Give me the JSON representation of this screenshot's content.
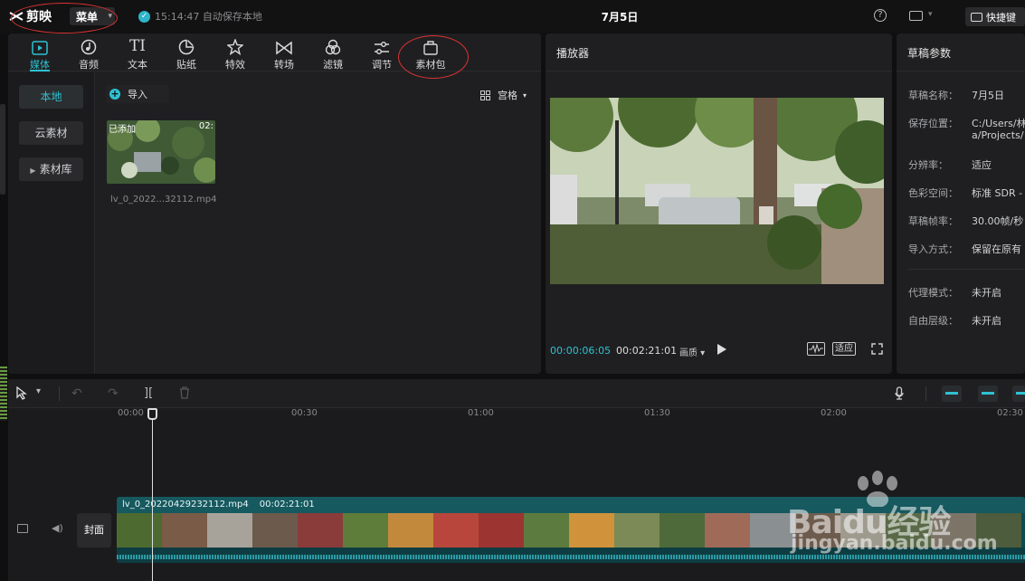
{
  "app": {
    "logo_text": "剪映",
    "menu_label": "菜单",
    "autosave_text": "15:14:47 自动保存本地",
    "project_title": "7月5日",
    "shortcut_label": "快捷键"
  },
  "tool_tabs": [
    {
      "label": "媒体",
      "icon": "media-icon"
    },
    {
      "label": "音频",
      "icon": "audio-icon"
    },
    {
      "label": "文本",
      "icon": "text-icon",
      "glyph": "TI"
    },
    {
      "label": "贴纸",
      "icon": "sticker-icon"
    },
    {
      "label": "特效",
      "icon": "effects-icon"
    },
    {
      "label": "转场",
      "icon": "transition-icon"
    },
    {
      "label": "滤镜",
      "icon": "filter-icon"
    },
    {
      "label": "调节",
      "icon": "adjust-icon"
    },
    {
      "label": "素材包",
      "icon": "material-pack-icon"
    }
  ],
  "media_sidebar": {
    "local": "本地",
    "cloud": "云素材",
    "library": "素材库"
  },
  "media": {
    "import_label": "导入",
    "view_label": "宫格",
    "added_badge": "已添加",
    "duration_short": "02:",
    "file_name": "lv_0_2022...32112.mp4"
  },
  "player": {
    "title": "播放器",
    "time_current": "00:00:06:05",
    "time_total": "00:02:21:01",
    "quality_label": "画质",
    "fit_label": "适应"
  },
  "params": {
    "title": "草稿参数",
    "rows": [
      {
        "label": "草稿名称：",
        "value": "7月5日"
      },
      {
        "label": "保存位置：",
        "value": "C:/Users/林",
        "value2": "a/Projects/"
      },
      {
        "label": "分辨率：",
        "value": "适应"
      },
      {
        "label": "色彩空间：",
        "value": "标准 SDR -"
      },
      {
        "label": "草稿帧率：",
        "value": "30.00帧/秒"
      },
      {
        "label": "导入方式：",
        "value": "保留在原有"
      },
      {
        "label": "代理模式：",
        "value": "未开启"
      },
      {
        "label": "自由层级：",
        "value": "未开启"
      }
    ]
  },
  "timeline": {
    "ticks": [
      "00:00",
      "00:30",
      "01:00",
      "01:30",
      "02:00",
      "02:30"
    ],
    "cover_label": "封面",
    "clip_name": "lv_0_20220429232112.mp4",
    "clip_duration": "00:02:21:01"
  },
  "watermark": {
    "text_main": "Baidu经验",
    "text_sub": "jingyan.baidu.com"
  },
  "colors": {
    "accent": "#2fc1d1",
    "clip_bg": "#0f4a50",
    "annotation": "#dd3333"
  }
}
